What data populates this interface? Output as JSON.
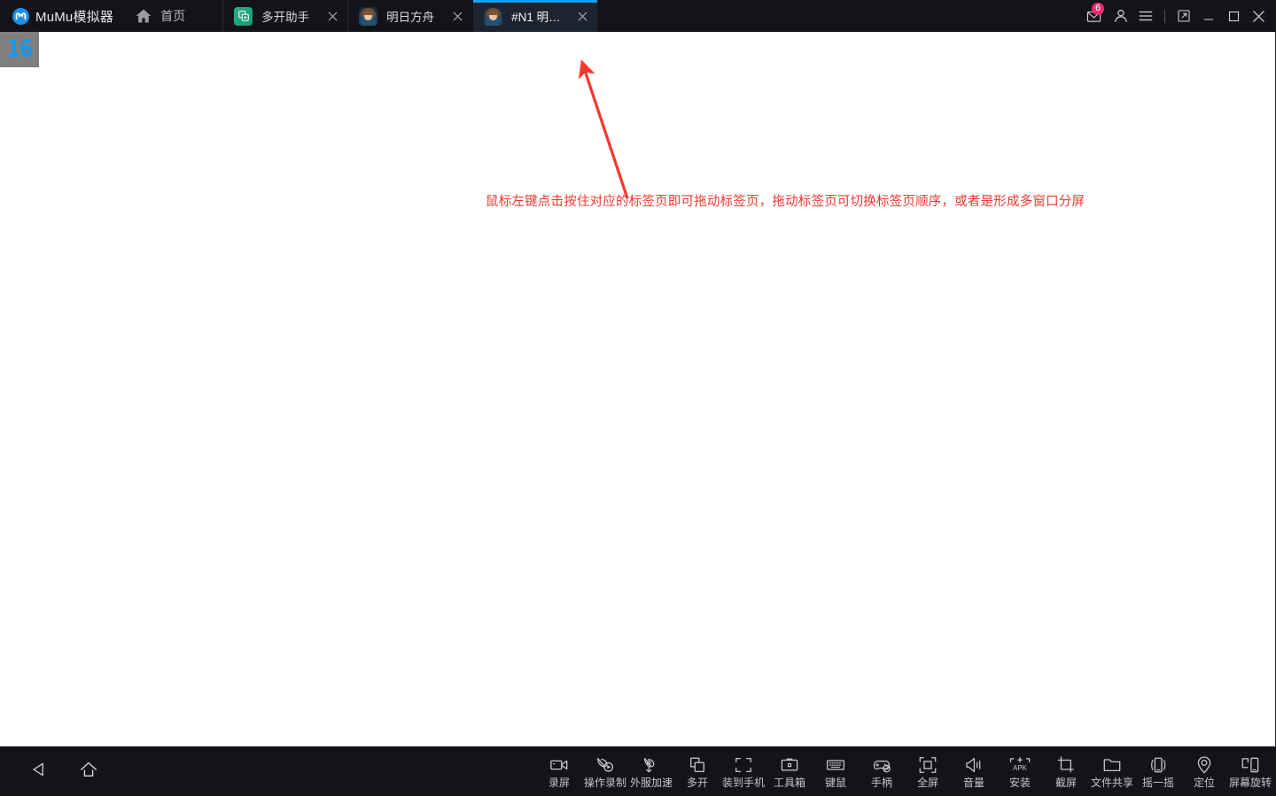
{
  "window": {
    "app_name": "MuMu模拟器",
    "home_label": "首页",
    "logo_icon": "mumu-logo-icon",
    "home_icon": "home-icon"
  },
  "tabs": [
    {
      "label": "多开助手",
      "icon": "multi-instance-icon",
      "active": false,
      "close_icon": "close-icon"
    },
    {
      "label": "明日方舟",
      "icon": "arknights-icon",
      "active": false,
      "close_icon": "close-icon"
    },
    {
      "label": "#N1 明日方...",
      "icon": "arknights-icon",
      "active": true,
      "close_icon": "close-icon"
    }
  ],
  "window_controls": {
    "message_icon": "mail-icon",
    "message_badge": "6",
    "account_icon": "user-icon",
    "menu_icon": "hamburger-menu-icon",
    "resize_icon": "resize-window-icon",
    "minimize_icon": "minimize-icon",
    "maximize_icon": "maximize-icon",
    "close_icon": "close-window-icon"
  },
  "content": {
    "fps_counter": "16",
    "annotation_text": "鼠标左键点击按住对应的标签页即可拖动标签页，拖动标签页可切换标签页顺序，或者是形成多窗口分屏",
    "annotation_color": "#f03a2f",
    "arrow_icon": "red-arrow-icon"
  },
  "bottom_bar": {
    "nav": [
      {
        "label": "back",
        "icon": "back-triangle-icon"
      },
      {
        "label": "home",
        "icon": "home-outline-icon"
      }
    ],
    "tools": [
      {
        "label": "录屏",
        "icon": "screen-record-icon"
      },
      {
        "label": "操作录制",
        "icon": "macro-record-icon"
      },
      {
        "label": "外服加速",
        "icon": "network-boost-icon"
      },
      {
        "label": "多开",
        "icon": "multi-window-icon"
      },
      {
        "label": "装到手机",
        "icon": "install-to-phone-icon"
      },
      {
        "label": "工具箱",
        "icon": "toolbox-icon"
      },
      {
        "label": "键鼠",
        "icon": "keyboard-mouse-icon"
      },
      {
        "label": "手柄",
        "icon": "gamepad-icon"
      },
      {
        "label": "全屏",
        "icon": "fullscreen-icon"
      },
      {
        "label": "音量",
        "icon": "volume-icon"
      },
      {
        "label": "安装",
        "icon": "install-apk-icon"
      },
      {
        "label": "截屏",
        "icon": "screenshot-icon"
      },
      {
        "label": "文件共享",
        "icon": "file-share-icon"
      },
      {
        "label": "摇一摇",
        "icon": "shake-icon"
      },
      {
        "label": "定位",
        "icon": "location-pin-icon"
      },
      {
        "label": "屏幕旋转",
        "icon": "screen-rotate-icon"
      }
    ]
  },
  "colors": {
    "titlebar_bg": "#141418",
    "active_tab_bg": "#1d2430",
    "accent_blue": "#18a0f0",
    "badge_pink": "#ec2a74",
    "fps_blue": "#0d9bf5"
  }
}
